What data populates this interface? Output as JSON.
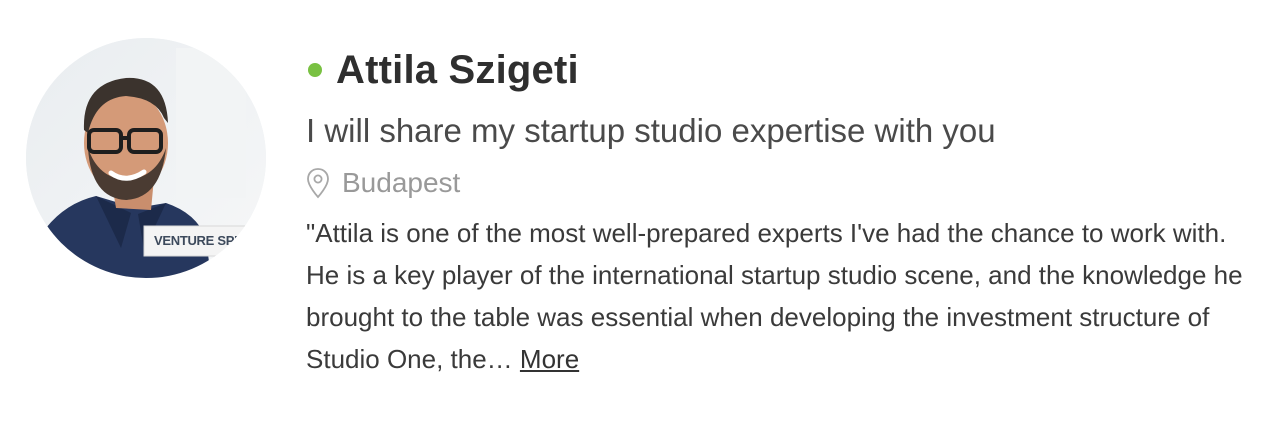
{
  "profile": {
    "name": "Attila Szigeti",
    "status_color": "#79c142",
    "tagline": "I will share my startup studio expertise with you",
    "location_icon": "map-pin-icon",
    "location": "Budapest",
    "avatar_badge": "VENTURE SPEED",
    "review_excerpt": "\"Attila is one of the most well-prepared experts I've had the chance to work with. He is a key player of the international startup studio scene, and the knowledge he brought to the table was essential when developing the investment structure of Studio One, the…",
    "more_label": "More"
  }
}
